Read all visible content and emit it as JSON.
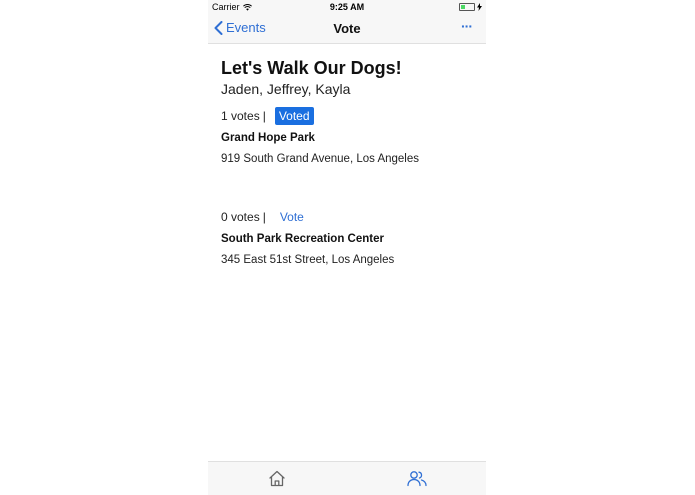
{
  "status_bar": {
    "carrier": "Carrier",
    "time": "9:25 AM"
  },
  "nav": {
    "back_label": "Events",
    "title": "Vote",
    "more_label": "···"
  },
  "event": {
    "title": "Let's Walk Our Dogs!",
    "people": "Jaden, Jeffrey, Kayla"
  },
  "options": [
    {
      "votes": "1 votes",
      "separator": "|",
      "action": "Voted",
      "voted": true,
      "name": "Grand Hope Park",
      "address": "919 South Grand Avenue, Los Angeles"
    },
    {
      "votes": "0 votes",
      "separator": "|",
      "action": "Vote",
      "voted": false,
      "name": "South Park Recreation Center",
      "address": "345 East 51st Street, Los Angeles"
    }
  ],
  "tabs": [
    {
      "icon": "home-icon"
    },
    {
      "icon": "people-icon"
    }
  ],
  "colors": {
    "accent": "#2f6fd4",
    "voted_bg": "#1a6fe0",
    "bar_bg": "#f7f7f7"
  }
}
